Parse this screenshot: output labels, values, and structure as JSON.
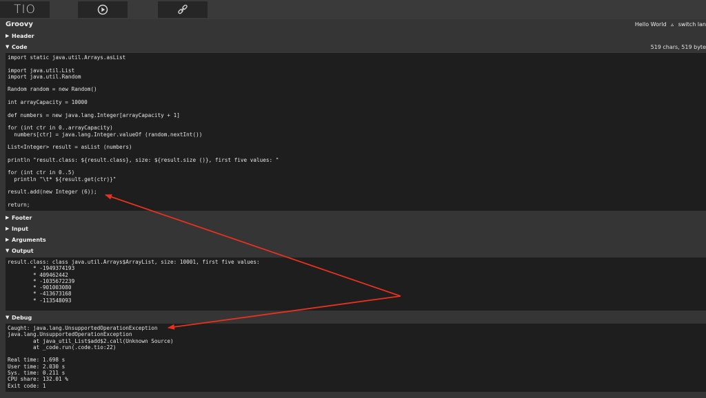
{
  "toolbar": {
    "logo_text": "TIO"
  },
  "language": {
    "name": "Groovy",
    "hello_world": "Hello World",
    "hello_world_icon": "triangle-icon",
    "switch_label": "switch lan"
  },
  "sections": {
    "header": {
      "label": "Header",
      "arrow": "▶"
    },
    "code": {
      "label": "Code",
      "arrow": "▼",
      "stats": "519 chars, 519 byte"
    },
    "footer": {
      "label": "Footer",
      "arrow": "▶"
    },
    "input": {
      "label": "Input",
      "arrow": "▶"
    },
    "arguments": {
      "label": "Arguments",
      "arrow": "▶"
    },
    "output": {
      "label": "Output",
      "arrow": "▼"
    },
    "debug": {
      "label": "Debug",
      "arrow": "▼"
    }
  },
  "code_lines": [
    "import static java.util.Arrays.asList",
    "",
    "import java.util.List",
    "import java.util.Random",
    "",
    "Random random = new Random()",
    "",
    "int arrayCapacity = 10000",
    "",
    "def numbers = new java.lang.Integer[arrayCapacity + 1]",
    "",
    "for (int ctr in 0..arrayCapacity)",
    "  numbers[ctr] = java.lang.Integer.valueOf (random.nextInt())",
    "",
    "List<Integer> result = asList (numbers)",
    "",
    "println \"result.class: ${result.class}, size: ${result.size ()}, first five values: \"",
    "",
    "for (int ctr in 0..5)",
    "  println \"\\t* ${result.get(ctr)}\"",
    "",
    "result.add(new Integer (6));",
    "",
    "return;"
  ],
  "output_lines": [
    "result.class: class java.util.Arrays$ArrayList, size: 10001, first five values:",
    "        * -1949374193",
    "        * 409462442",
    "        * -1035672239",
    "        * -901003080",
    "        * -413673168",
    "        * -113548093"
  ],
  "debug_lines": [
    "Caught: java.lang.UnsupportedOperationException",
    "java.lang.UnsupportedOperationException",
    "        at java_util_List$add$2.call(Unknown Source)",
    "        at _code.run(.code.tio:22)",
    "",
    "Real time: 1.698 s",
    "User time: 2.030 s",
    "Sys. time: 0.211 s",
    "CPU share: 132.01 %",
    "Exit code: 1"
  ],
  "colors": {
    "annotation_arrow": "#e8321e",
    "background": "#353535",
    "code_background": "#1e1e1e"
  }
}
